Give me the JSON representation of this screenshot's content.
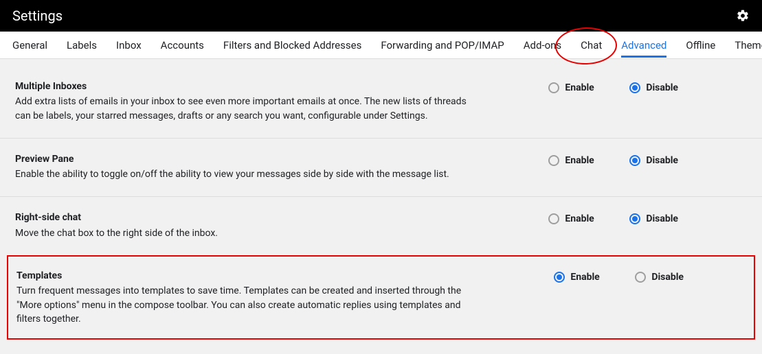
{
  "header": {
    "title": "Settings"
  },
  "tabs": [
    {
      "label": "General",
      "active": false
    },
    {
      "label": "Labels",
      "active": false
    },
    {
      "label": "Inbox",
      "active": false
    },
    {
      "label": "Accounts",
      "active": false
    },
    {
      "label": "Filters and Blocked Addresses",
      "active": false
    },
    {
      "label": "Forwarding and POP/IMAP",
      "active": false
    },
    {
      "label": "Add-ons",
      "active": false
    },
    {
      "label": "Chat",
      "active": false
    },
    {
      "label": "Advanced",
      "active": true
    },
    {
      "label": "Offline",
      "active": false
    },
    {
      "label": "Themes",
      "active": false
    }
  ],
  "radio_labels": {
    "enable": "Enable",
    "disable": "Disable"
  },
  "settings": [
    {
      "title": "Multiple Inboxes",
      "desc": "Add extra lists of emails in your inbox to see even more important emails at once. The new lists of threads can be labels, your starred messages, drafts or any search you want, configurable under Settings.",
      "value": "disable"
    },
    {
      "title": "Preview Pane",
      "desc": "Enable the ability to toggle on/off the ability to view your messages side by side with the message list.",
      "value": "disable"
    },
    {
      "title": "Right-side chat",
      "desc": "Move the chat box to the right side of the inbox.",
      "value": "disable"
    },
    {
      "title": "Templates",
      "desc": "Turn frequent messages into templates to save time. Templates can be created and inserted through the \"More options\" menu in the compose toolbar. You can also create automatic replies using templates and filters together.",
      "value": "enable",
      "highlighted": true
    }
  ]
}
